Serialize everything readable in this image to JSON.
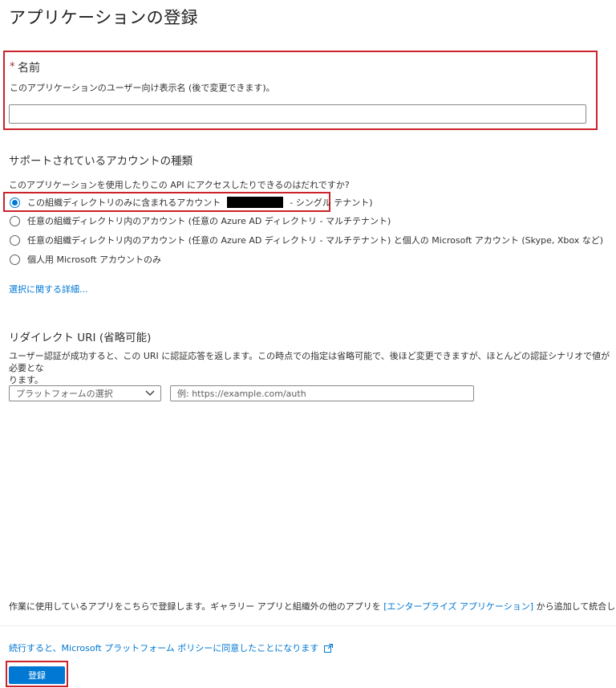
{
  "page": {
    "title": "アプリケーションの登録",
    "more": "···"
  },
  "name_section": {
    "required_mark": "*",
    "label": "名前",
    "description": "このアプリケーションのユーザー向け表示名 (後で変更できます)。",
    "value": ""
  },
  "accounts": {
    "heading": "サポートされているアカウントの種類",
    "question": "このアプリケーションを使用したりこの API にアクセスしたりできるのはだれですか?",
    "options": [
      {
        "label": "この組織ディレクトリのみに含まれるアカウント",
        "suffix": "- シングル テナント)",
        "selected": true
      },
      {
        "label": "任意の組織ディレクトリ内のアカウント (任意の Azure AD ディレクトリ - マルチテナント)",
        "selected": false
      },
      {
        "label": "任意の組織ディレクトリ内のアカウント (任意の Azure AD ディレクトリ - マルチテナント) と個人の Microsoft アカウント (Skype, Xbox など)",
        "selected": false
      },
      {
        "label": "個人用 Microsoft アカウントのみ",
        "selected": false
      }
    ],
    "details_link": "選択に関する詳細..."
  },
  "redirect": {
    "heading": "リダイレクト URI (省略可能)",
    "description_line1": "ユーザー認証が成功すると、この URI に認証応答を返します。この時点での指定は省略可能で、後ほど変更できますが、ほとんどの認証シナリオで値が必要とな",
    "description_line2": "ります。",
    "platform_placeholder": "プラットフォームの選択",
    "uri_placeholder": "例: https://example.com/auth"
  },
  "footer": {
    "note_prefix": "作業に使用しているアプリをこちらで登録します。ギャラリー アプリと組織外の他のアプリを ",
    "note_link": "[エンタープライズ アプリケーション]",
    "note_suffix": " から追加して統合します。",
    "policy_link": "続行すると、Microsoft プラットフォーム ポリシーに同意したことになります",
    "register_label": "登録"
  },
  "colors": {
    "accent": "#0078d4",
    "highlight": "#cc2229"
  }
}
